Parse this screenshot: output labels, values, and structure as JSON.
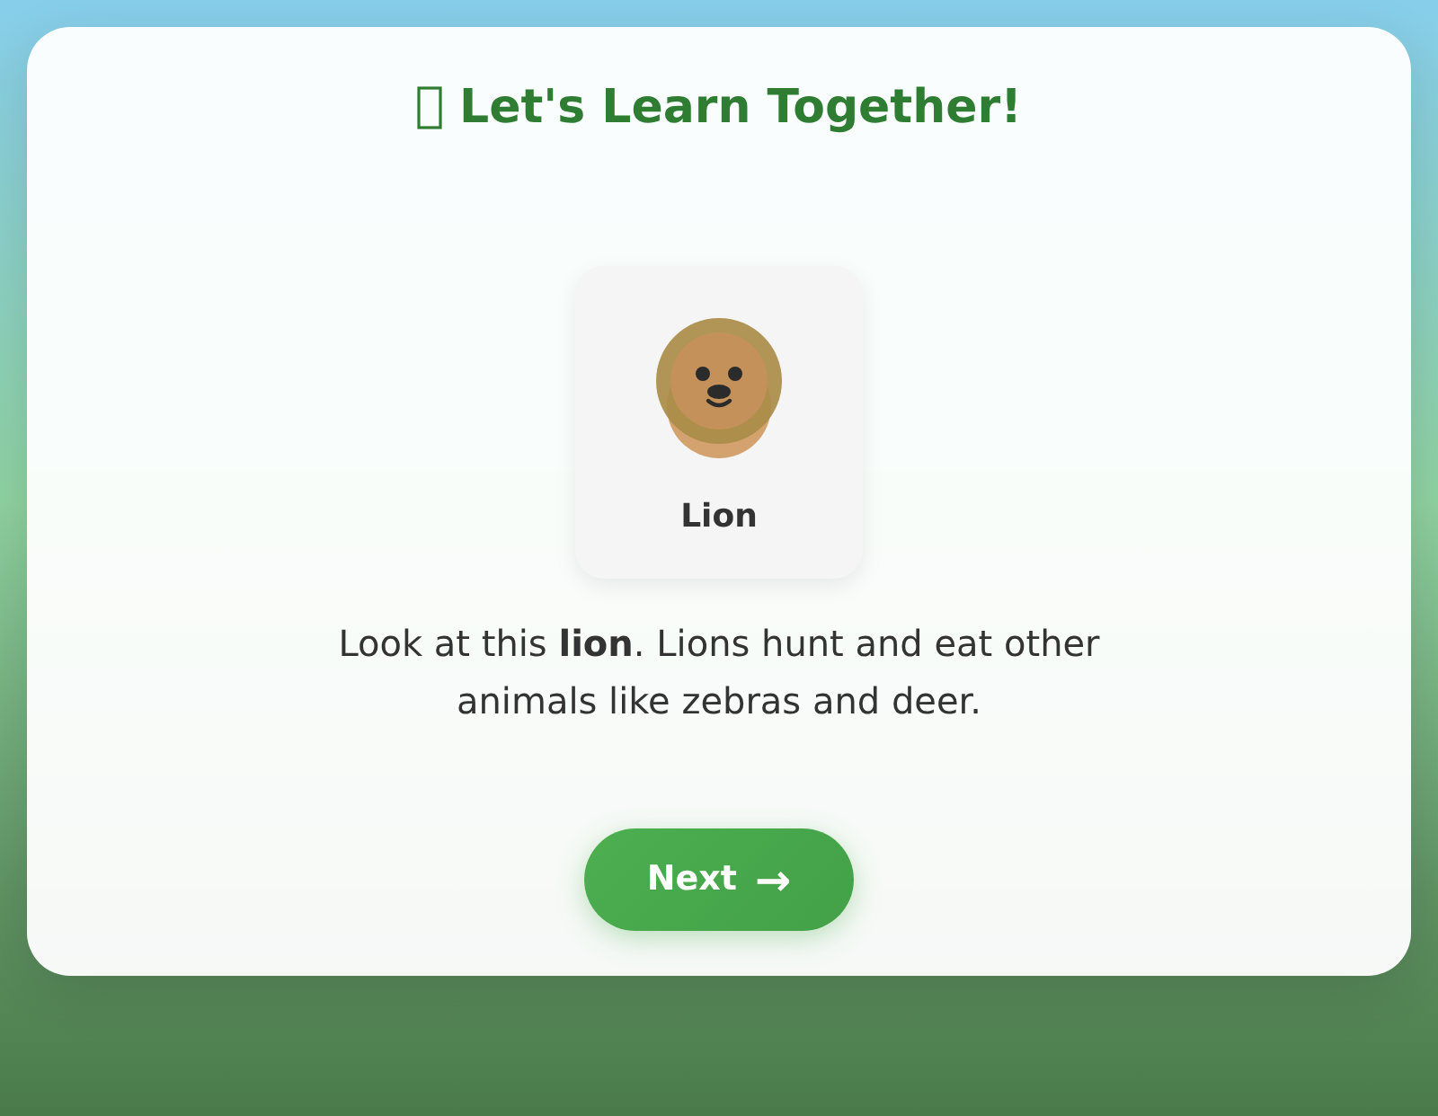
{
  "title": {
    "text": "Let's Learn Together!"
  },
  "animal_card": {
    "name": "Lion"
  },
  "description": "Look at this **lion**. Lions hunt and eat other animals like zebras and deer.",
  "next_button": {
    "label": "Next",
    "icon": "→"
  }
}
